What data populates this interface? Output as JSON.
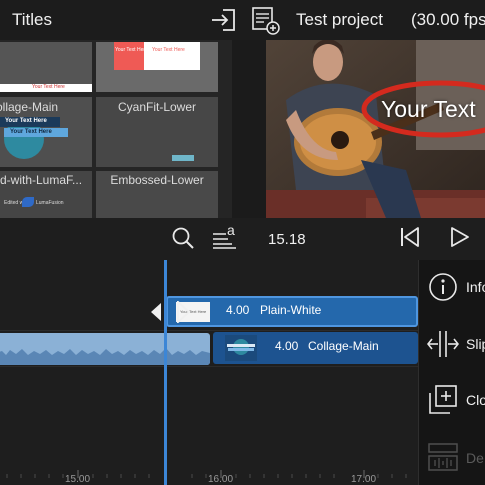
{
  "header": {
    "title": "Titles",
    "project_name": "Test project",
    "frame_rate": "(30.00 fps"
  },
  "browser": {
    "tiles": [
      {
        "id": "t1",
        "label": "",
        "thumb_text": "Your Text Here"
      },
      {
        "id": "t2",
        "label": "",
        "thumb_text_a": "Your Text Here",
        "thumb_text_b": "Your Text Here"
      },
      {
        "id": "t3",
        "label": "ollage-Main",
        "thumb_line1": "Your Text Here",
        "thumb_line2": "Your Text Here"
      },
      {
        "id": "t4",
        "label": "CyanFit-Lower"
      },
      {
        "id": "t5",
        "label": "d-with-LumaF...",
        "thumb_text": "Edited with",
        "thumb_brand": "LumaFusion"
      },
      {
        "id": "t6",
        "label": "Embossed-Lower"
      }
    ]
  },
  "preview": {
    "overlay_text": "Your Text"
  },
  "toolbar": {
    "timecode": "15.18"
  },
  "timeline": {
    "clips": [
      {
        "id": "c1",
        "duration": "4.00",
        "name": "Plain-White",
        "thumb_text": "Your Text Here"
      },
      {
        "id": "c2",
        "duration": "4.00",
        "name": "Collage-Main"
      }
    ],
    "ruler": [
      "15.00",
      "16.00",
      "17.00"
    ]
  },
  "side_panel": {
    "items": [
      {
        "id": "info",
        "label": "Info",
        "icon": "info-icon",
        "enabled": true
      },
      {
        "id": "slip",
        "label": "Slip",
        "icon": "slip-icon",
        "enabled": true
      },
      {
        "id": "clone",
        "label": "Clo",
        "icon": "clone-icon",
        "enabled": true
      },
      {
        "id": "detach",
        "label": "De",
        "icon": "detach-audio-icon",
        "enabled": false
      }
    ]
  },
  "colors": {
    "clip_blue": "#1f5c9a",
    "clip_selected_blue": "#2f74c0",
    "playhead": "#3c86d6",
    "annotation_red": "#d42a1e"
  }
}
